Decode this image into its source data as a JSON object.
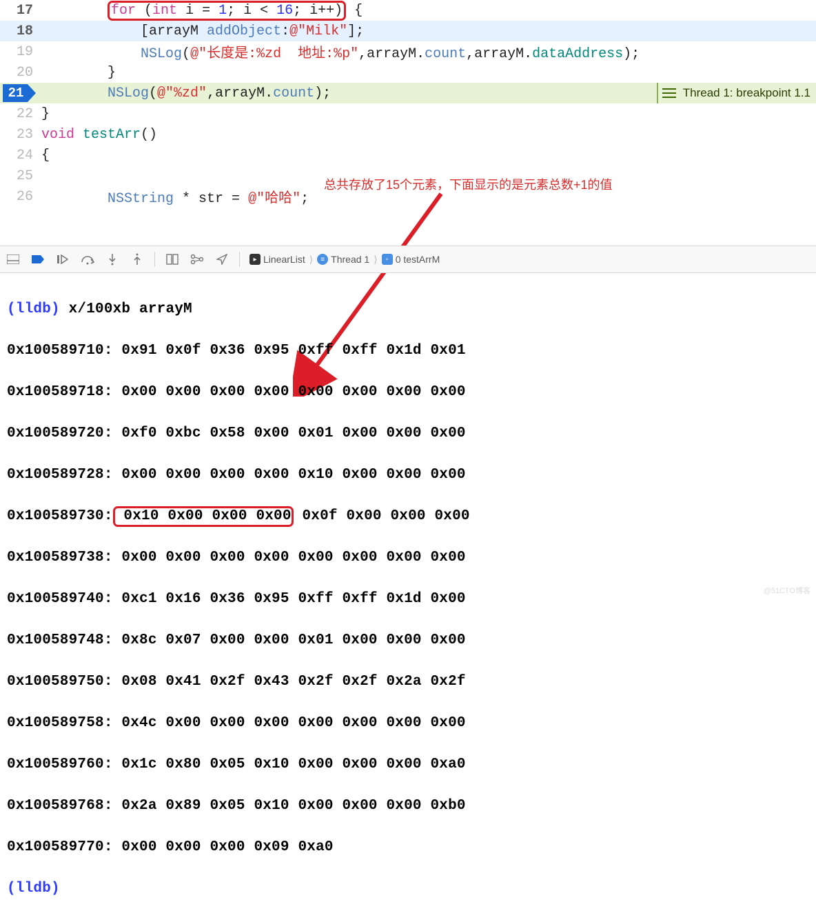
{
  "editor": {
    "lines": {
      "17": {
        "n": "17",
        "bold": true
      },
      "18": {
        "n": "18",
        "bold": true
      },
      "19": {
        "n": "19"
      },
      "20": {
        "n": "20"
      },
      "21": {
        "n": "21"
      },
      "22": {
        "n": "22"
      },
      "23": {
        "n": "23"
      },
      "24": {
        "n": "24"
      },
      "25": {
        "n": "25"
      },
      "26": {
        "n": "26"
      }
    },
    "tokens": {
      "l17_for": "for",
      "l17_int": "int",
      "l17_ieq": " i = ",
      "l17_one": "1",
      "l17_semi1": "; i < ",
      "l17_sixteen": "16",
      "l17_tail": "; i++)",
      "l17_brace": " {",
      "l18_open": "            [arrayM ",
      "l18_add": "addObject",
      "l18_colon": ":",
      "l18_at": "@\"Milk\"",
      "l18_close": "];",
      "l19_pre": "            ",
      "l19_nslog": "NSLog",
      "l19_open": "(",
      "l19_str": "@\"长度是:%zd  地址:%p\"",
      "l19_mid": ",arrayM.",
      "l19_count": "count",
      "l19_mid2": ",arrayM.",
      "l19_da": "dataAddress",
      "l19_end": ");",
      "l20": "        }",
      "l21_pre": "        ",
      "l21_nslog": "NSLog",
      "l21_open": "(",
      "l21_str": "@\"%zd\"",
      "l21_mid": ",arrayM.",
      "l21_count": "count",
      "l21_end": ");",
      "l22": "}",
      "l23_void": "void",
      "l23_fn": " testArr",
      "l23_p": "()",
      "l24": "{",
      "l26_pre": "        ",
      "l26_type": "NSString",
      "l26_mid": " * str = ",
      "l26_str": "@\"哈哈\"",
      "l26_end": ";"
    }
  },
  "breakpoint": {
    "label": "Thread 1: breakpoint 1.1"
  },
  "annotation": {
    "text": "总共存放了15个元素，下面显示的是元素总数+1的值"
  },
  "toolbar": {
    "crumbs": {
      "target": "LinearList",
      "thread": "Thread 1",
      "frame": "0 testArrM"
    }
  },
  "console": {
    "prompt": "(lldb) ",
    "cmd": "x/100xb arrayM",
    "rows": [
      {
        "a": "0x100589710:",
        "b": " 0x91 0x0f 0x36 0x95 0xff 0xff 0x1d 0x01"
      },
      {
        "a": "0x100589718:",
        "b": " 0x00 0x00 0x00 0x00 0x00 0x00 0x00 0x00"
      },
      {
        "a": "0x100589720:",
        "b": " 0xf0 0xbc 0x58 0x00 0x01 0x00 0x00 0x00"
      },
      {
        "a": "0x100589728:",
        "b": " 0x00 0x00 0x00 0x00 0x10 0x00 0x00 0x00"
      },
      {
        "a": "0x100589730:",
        "b1": " 0x10 0x00 0x00 0x00",
        "b2": " 0x0f 0x00 0x00 0x00",
        "boxed": true
      },
      {
        "a": "0x100589738:",
        "b": " 0x00 0x00 0x00 0x00 0x00 0x00 0x00 0x00"
      },
      {
        "a": "0x100589740:",
        "b": " 0xc1 0x16 0x36 0x95 0xff 0xff 0x1d 0x00"
      },
      {
        "a": "0x100589748:",
        "b": " 0x8c 0x07 0x00 0x00 0x01 0x00 0x00 0x00"
      },
      {
        "a": "0x100589750:",
        "b": " 0x08 0x41 0x2f 0x43 0x2f 0x2f 0x2a 0x2f"
      },
      {
        "a": "0x100589758:",
        "b": " 0x4c 0x00 0x00 0x00 0x00 0x00 0x00 0x00"
      },
      {
        "a": "0x100589760:",
        "b": " 0x1c 0x80 0x05 0x10 0x00 0x00 0x00 0xa0"
      },
      {
        "a": "0x100589768:",
        "b": " 0x2a 0x89 0x05 0x10 0x00 0x00 0x00 0xb0"
      },
      {
        "a": "0x100589770:",
        "b": " 0x00 0x00 0x00 0x09 0xa0"
      }
    ],
    "prompt2": "(lldb) "
  },
  "watermark": "@51CTO博客"
}
